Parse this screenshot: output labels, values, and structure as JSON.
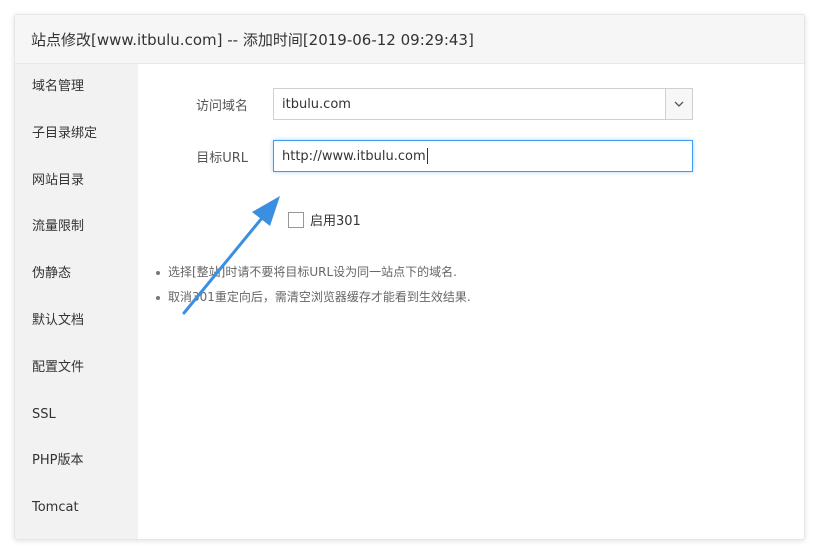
{
  "dialog": {
    "title": "站点修改[www.itbulu.com] -- 添加时间[2019-06-12 09:29:43]"
  },
  "sidebar": {
    "items": [
      {
        "label": "域名管理"
      },
      {
        "label": "子目录绑定"
      },
      {
        "label": "网站目录"
      },
      {
        "label": "流量限制"
      },
      {
        "label": "伪静态"
      },
      {
        "label": "默认文档"
      },
      {
        "label": "配置文件"
      },
      {
        "label": "SSL"
      },
      {
        "label": "PHP版本"
      },
      {
        "label": "Tomcat"
      }
    ]
  },
  "form": {
    "domain_label": "访问域名",
    "domain_value": "itbulu.com",
    "target_label": "目标URL",
    "target_value": "http://www.itbulu.com",
    "enable301_label": "启用301",
    "enable301_checked": false
  },
  "notes": [
    "选择[整站]时请不要将目标URL设为同一站点下的域名.",
    "取消301重定向后，需清空浏览器缓存才能看到生效结果."
  ],
  "colors": {
    "accent": "#3e9cf4",
    "arrow": "#3a8fe0"
  }
}
